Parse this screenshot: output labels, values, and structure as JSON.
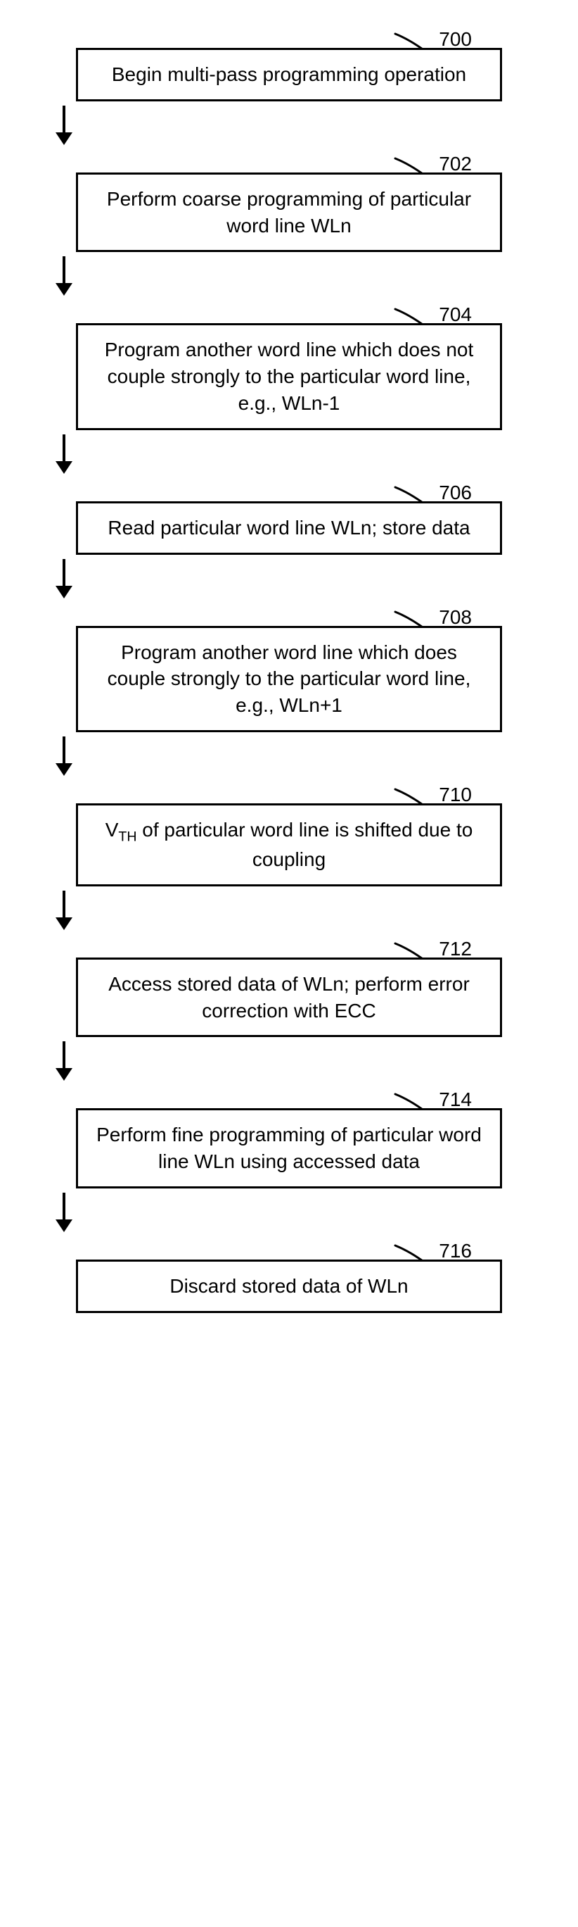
{
  "steps": [
    {
      "num": "700",
      "text": "Begin multi-pass programming operation"
    },
    {
      "num": "702",
      "text": "Perform coarse programming of particular word line WLn"
    },
    {
      "num": "704",
      "text": "Program another word line which does not couple strongly to the particular word line, e.g., WLn-1"
    },
    {
      "num": "706",
      "text": "Read particular word line WLn; store data"
    },
    {
      "num": "708",
      "text": "Program another word line which does couple strongly to the particular word line, e.g., WLn+1"
    },
    {
      "num": "710",
      "html": "V<sub>TH</sub> of particular word line is shifted due to coupling"
    },
    {
      "num": "712",
      "text": "Access stored data of WLn; perform error correction with ECC"
    },
    {
      "num": "714",
      "text": "Perform fine programming of particular word line WLn using accessed data"
    },
    {
      "num": "716",
      "text": "Discard stored data of WLn"
    }
  ]
}
